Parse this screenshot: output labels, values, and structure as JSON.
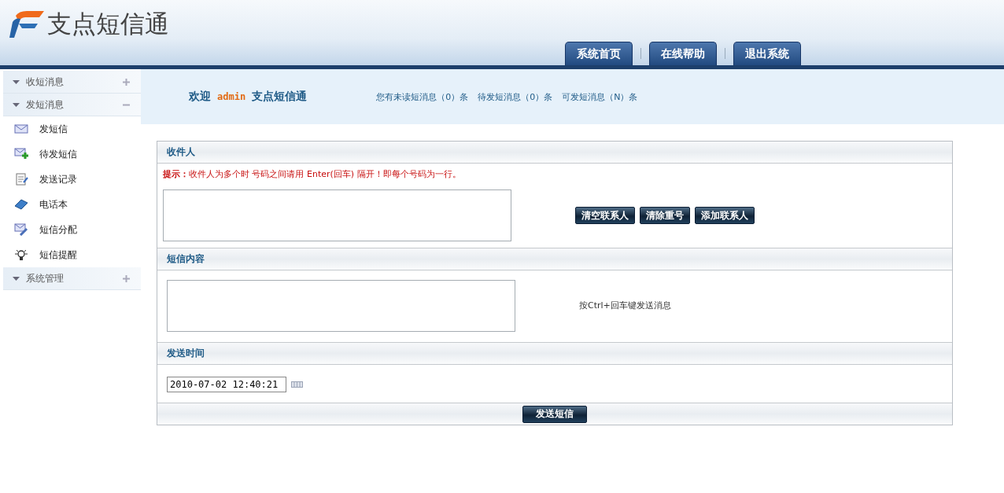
{
  "header": {
    "logo_text": "支点短信通",
    "nav": [
      {
        "label": "系统首页"
      },
      {
        "label": "在线帮助"
      },
      {
        "label": "退出系统"
      }
    ]
  },
  "sidebar": {
    "groups": [
      {
        "label": "收短消息",
        "expanded": false
      },
      {
        "label": "发短消息",
        "expanded": true,
        "items": [
          {
            "label": "发短信"
          },
          {
            "label": "待发短信"
          },
          {
            "label": "发送记录"
          },
          {
            "label": "电话本"
          },
          {
            "label": "短信分配"
          },
          {
            "label": "短信提醒"
          }
        ]
      },
      {
        "label": "系统管理",
        "expanded": false
      }
    ]
  },
  "welcome": {
    "greeting": "欢迎",
    "user": "admin",
    "app": "支点短信通",
    "stats": [
      "您有未读短消息（0）条",
      "待发短消息（0）条",
      "可发短消息（N）条"
    ]
  },
  "form": {
    "recipients": {
      "title": "收件人",
      "hint": "**提示：**收件人为多个时 号码之间请用 Enter(回车) 隔开！即每个号码为一行。",
      "buttons": [
        {
          "label": "清空联系人"
        },
        {
          "label": "清除重号"
        },
        {
          "label": "添加联系人"
        }
      ]
    },
    "content": {
      "title": "短信内容",
      "hint": "按Ctrl+回车键发送消息"
    },
    "send_time": {
      "title": "发送时间",
      "value": "2010-07-02 12:40:21"
    },
    "submit": {
      "label": "发送短信"
    }
  }
}
